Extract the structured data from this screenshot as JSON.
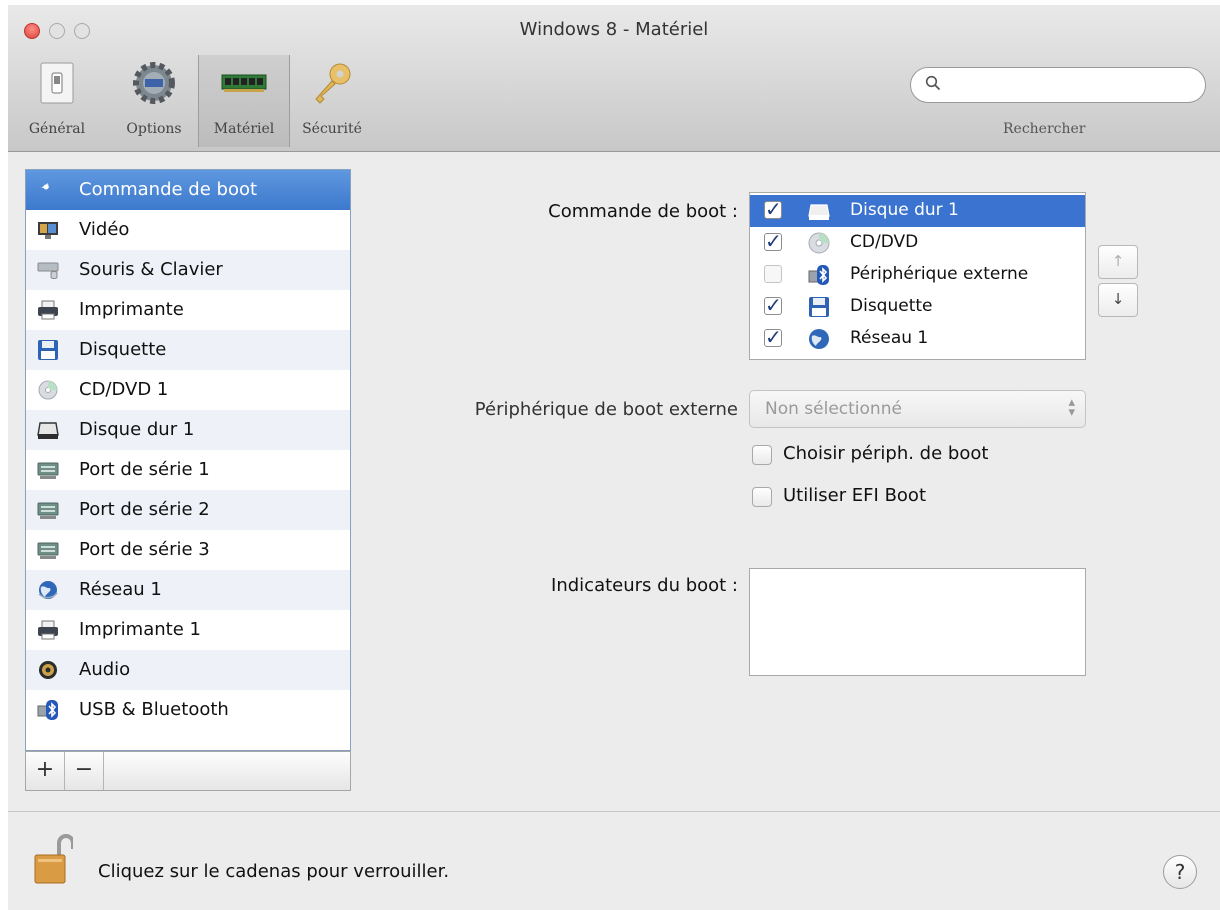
{
  "window": {
    "title": "Windows 8 - Matériel"
  },
  "toolbar": {
    "tabs": [
      {
        "label": "Général",
        "icon": "general-switch-icon"
      },
      {
        "label": "Options",
        "icon": "gear-icon"
      },
      {
        "label": "Matériel",
        "icon": "memory-chip-icon",
        "selected": true
      },
      {
        "label": "Sécurité",
        "icon": "key-icon"
      }
    ],
    "search": {
      "placeholder": "",
      "caption": "Rechercher"
    }
  },
  "sidebar": {
    "items": [
      {
        "label": "Commande de boot",
        "icon": "boot-order-icon",
        "selected": true
      },
      {
        "label": "Vidéo",
        "icon": "video-icon"
      },
      {
        "label": "Souris & Clavier",
        "icon": "keyboard-mouse-icon"
      },
      {
        "label": "Imprimante",
        "icon": "printer-icon"
      },
      {
        "label": "Disquette",
        "icon": "floppy-icon"
      },
      {
        "label": "CD/DVD 1",
        "icon": "cd-dvd-icon"
      },
      {
        "label": "Disque dur 1",
        "icon": "hard-disk-icon"
      },
      {
        "label": "Port de série 1",
        "icon": "serial-port-icon"
      },
      {
        "label": "Port de série 2",
        "icon": "serial-port-icon"
      },
      {
        "label": "Port de série 3",
        "icon": "serial-port-icon"
      },
      {
        "label": "Réseau 1",
        "icon": "network-globe-icon"
      },
      {
        "label": "Imprimante 1",
        "icon": "printer-icon"
      },
      {
        "label": "Audio",
        "icon": "audio-speaker-icon"
      },
      {
        "label": "USB & Bluetooth",
        "icon": "usb-bluetooth-icon"
      }
    ],
    "add_label": "+",
    "remove_label": "−"
  },
  "boot": {
    "order_label": "Commande de boot :",
    "order": [
      {
        "label": "Disque dur 1",
        "checked": true,
        "icon": "hard-disk-icon",
        "selected": true
      },
      {
        "label": "CD/DVD",
        "checked": true,
        "icon": "cd-dvd-icon"
      },
      {
        "label": "Périphérique externe",
        "checked": false,
        "icon": "usb-icon"
      },
      {
        "label": "Disquette",
        "checked": true,
        "icon": "floppy-icon"
      },
      {
        "label": "Réseau 1",
        "checked": true,
        "icon": "network-globe-icon"
      }
    ],
    "move_up": "↑",
    "move_down": "↓",
    "external_label": "Périphérique de boot externe",
    "external_value": "Non sélectionné",
    "choose_device_label": "Choisir périph. de boot",
    "choose_device_checked": false,
    "efi_label": "Utiliser EFI Boot",
    "efi_checked": false,
    "flags_label": "Indicateurs du boot :",
    "flags_value": ""
  },
  "footer": {
    "lock_text": "Cliquez sur le cadenas pour verrouiller.",
    "help_label": "?"
  }
}
